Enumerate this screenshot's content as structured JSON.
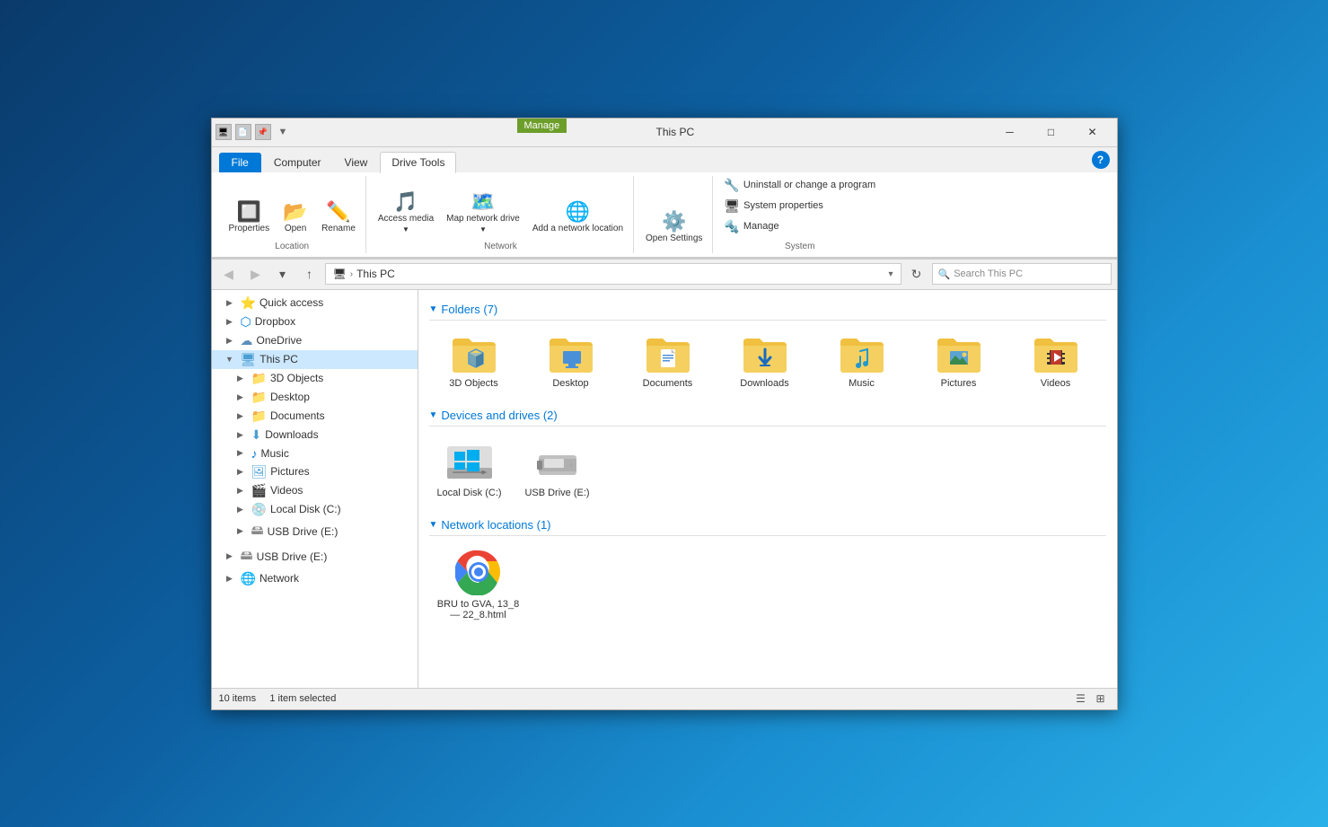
{
  "window": {
    "title": "This PC",
    "manage_label": "Manage",
    "min_btn": "─",
    "max_btn": "□",
    "close_btn": "✕"
  },
  "ribbon": {
    "tabs": [
      "File",
      "Computer",
      "View",
      "Drive Tools"
    ],
    "active_tab": "Computer",
    "groups": {
      "location": {
        "label": "Location",
        "buttons": [
          {
            "label": "Properties",
            "icon": "🔲"
          },
          {
            "label": "Open",
            "icon": "📂"
          },
          {
            "label": "Rename",
            "icon": "✏"
          }
        ]
      },
      "network": {
        "label": "Network",
        "buttons": [
          {
            "label": "Access media",
            "icon": "🎵"
          },
          {
            "label": "Map network drive",
            "icon": "🗺"
          },
          {
            "label": "Add a network location",
            "icon": "🌐"
          }
        ]
      },
      "settings": {
        "label": "",
        "buttons": [
          {
            "label": "Open Settings",
            "icon": "⚙"
          }
        ]
      },
      "system": {
        "label": "System",
        "buttons": [
          {
            "label": "Uninstall or change a program"
          },
          {
            "label": "System properties"
          },
          {
            "label": "Manage"
          }
        ]
      }
    }
  },
  "address_bar": {
    "path_icon": "🖥",
    "path": "This PC",
    "search_placeholder": "Search This PC"
  },
  "sidebar": {
    "items": [
      {
        "label": "Quick access",
        "icon": "⭐",
        "indent": 1,
        "expand": "▶"
      },
      {
        "label": "Dropbox",
        "icon": "🔵",
        "indent": 1,
        "expand": "▶"
      },
      {
        "label": "OneDrive",
        "icon": "☁",
        "indent": 1,
        "expand": "▶"
      },
      {
        "label": "This PC",
        "icon": "🖥",
        "indent": 1,
        "expand": "▼",
        "selected": true
      },
      {
        "label": "3D Objects",
        "icon": "📁",
        "indent": 2,
        "expand": "▶"
      },
      {
        "label": "Desktop",
        "icon": "📁",
        "indent": 2,
        "expand": "▶"
      },
      {
        "label": "Documents",
        "icon": "📁",
        "indent": 2,
        "expand": "▶"
      },
      {
        "label": "Downloads",
        "icon": "📥",
        "indent": 2,
        "expand": "▶"
      },
      {
        "label": "Music",
        "icon": "🎵",
        "indent": 2,
        "expand": "▶"
      },
      {
        "label": "Pictures",
        "icon": "🖼",
        "indent": 2,
        "expand": "▶"
      },
      {
        "label": "Videos",
        "icon": "🎬",
        "indent": 2,
        "expand": "▶"
      },
      {
        "label": "Local Disk (C:)",
        "icon": "💿",
        "indent": 2,
        "expand": "▶"
      },
      {
        "label": "USB Drive (E:)",
        "icon": "🖴",
        "indent": 2,
        "expand": "▶"
      },
      {
        "label": "USB Drive (E:)",
        "icon": "🖴",
        "indent": 1,
        "expand": "▶"
      },
      {
        "label": "Network",
        "icon": "🌐",
        "indent": 1,
        "expand": "▶"
      }
    ]
  },
  "content": {
    "folders_header": "Folders (7)",
    "folders": [
      {
        "label": "3D Objects",
        "type": "folder-3d"
      },
      {
        "label": "Desktop",
        "type": "folder-desktop"
      },
      {
        "label": "Documents",
        "type": "folder-docs"
      },
      {
        "label": "Downloads",
        "type": "folder-downloads"
      },
      {
        "label": "Music",
        "type": "folder-music"
      },
      {
        "label": "Pictures",
        "type": "folder-pictures"
      },
      {
        "label": "Videos",
        "type": "folder-videos"
      }
    ],
    "devices_header": "Devices and drives (2)",
    "devices": [
      {
        "label": "Local Disk (C:)",
        "type": "hdd"
      },
      {
        "label": "USB Drive (E:)",
        "type": "usb"
      }
    ],
    "network_header": "Network locations (1)",
    "network_items": [
      {
        "label": "BRU to GVA, 13_8\n— 22_8.html",
        "type": "chrome"
      }
    ]
  },
  "status_bar": {
    "items_count": "10 items",
    "selected_count": "1 item selected"
  }
}
